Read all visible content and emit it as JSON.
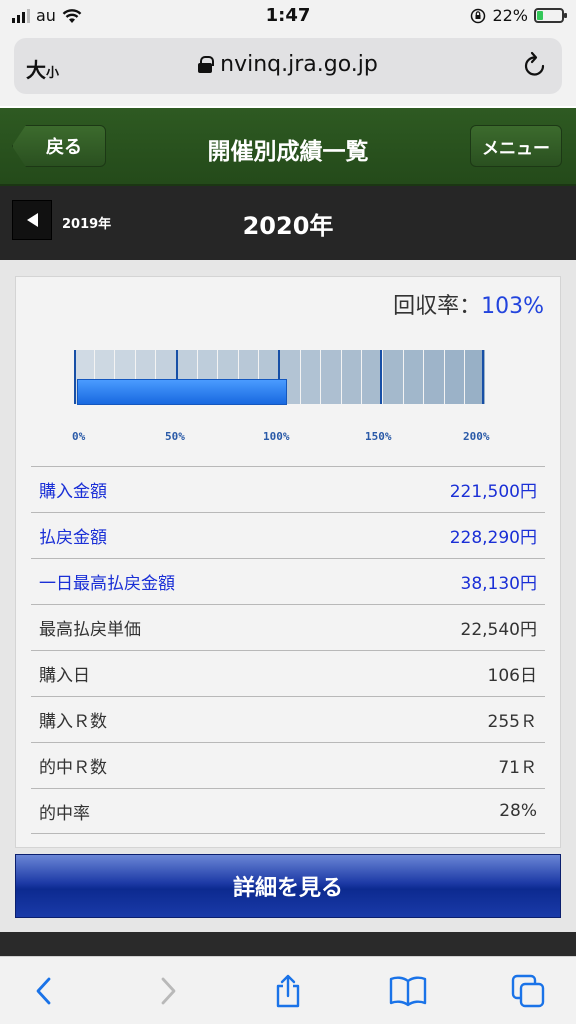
{
  "status_bar": {
    "carrier": "au",
    "time": "1:47",
    "battery": "22%"
  },
  "browser": {
    "text_size_label": "大",
    "text_size_small": "小",
    "url": "nvinq.jra.go.jp"
  },
  "header": {
    "back_label": "戻る",
    "title": "開催別成績一覧",
    "menu_label": "メニュー"
  },
  "year_nav": {
    "prev_year": "2019年",
    "current_year": "2020年"
  },
  "summary": {
    "recovery_label": "回収率：",
    "recovery_value": "103%",
    "gauge_value_percent": 103,
    "gauge_ticks": [
      "0%",
      "50%",
      "100%",
      "150%",
      "200%"
    ]
  },
  "stats": [
    {
      "label": "購入金額",
      "value": "221,500円",
      "link": true
    },
    {
      "label": "払戻金額",
      "value": "228,290円",
      "link": true
    },
    {
      "label": "一日最高払戻金額",
      "value": "38,130円",
      "link": true
    },
    {
      "label": "最高払戻単価",
      "value": "22,540円",
      "link": false
    },
    {
      "label": "購入日",
      "value": "106日",
      "link": false
    },
    {
      "label": "購入Ｒ数",
      "value": "255Ｒ",
      "link": false
    },
    {
      "label": "的中Ｒ数",
      "value": "71Ｒ",
      "link": false
    },
    {
      "label": "的中率",
      "value": "28%",
      "link": false
    }
  ],
  "detail_button": "詳細を見る",
  "colors": {
    "header_green": "#2e5a22",
    "link_blue": "#1a2fd6",
    "gauge_blue": "#1869e0"
  }
}
